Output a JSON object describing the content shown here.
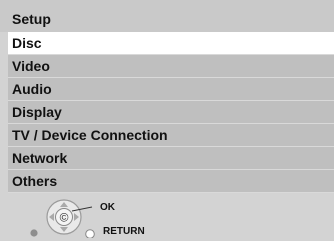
{
  "header": {
    "title": "Setup"
  },
  "menu": {
    "items": [
      {
        "label": "Disc",
        "selected": true
      },
      {
        "label": "Video",
        "selected": false
      },
      {
        "label": "Audio",
        "selected": false
      },
      {
        "label": "Display",
        "selected": false
      },
      {
        "label": "TV / Device Connection",
        "selected": false
      },
      {
        "label": "Network",
        "selected": false
      },
      {
        "label": "Others",
        "selected": false
      }
    ]
  },
  "legend": {
    "ok_label": "OK",
    "return_label": "RETURN",
    "dpad_icon": "remote-dpad-icon",
    "dpad_center_glyph": "©"
  },
  "colors": {
    "background": "#d3d3d3",
    "menu_item": "#bfbfbf",
    "selected_item": "#ffffff"
  }
}
